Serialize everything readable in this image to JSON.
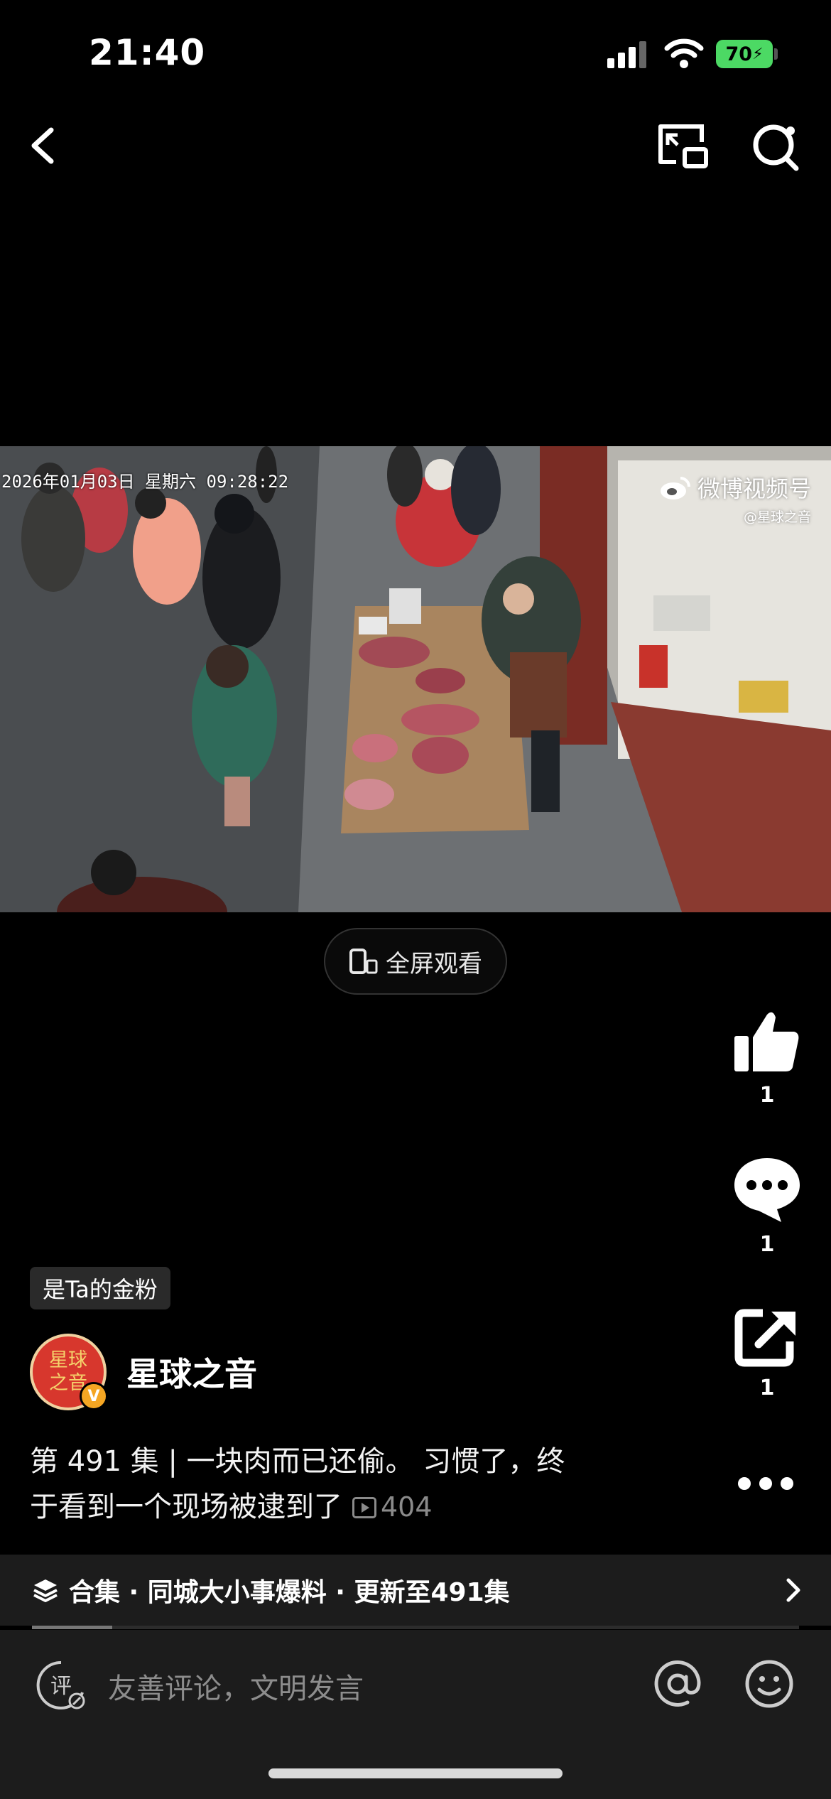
{
  "status_bar": {
    "time": "21:40",
    "battery": "70"
  },
  "video": {
    "timestamp": "2026年01月03日 星期六 09:28:22",
    "watermark": "微博视频号",
    "watermark_handle": "@星球之音",
    "fullscreen_label": "全屏观看"
  },
  "actions": {
    "like_count": "1",
    "comment_count": "1",
    "share_count": "1"
  },
  "author": {
    "fan_tag": "是Ta的金粉",
    "name": "星球之音",
    "avatar_line1": "星球",
    "avatar_line2": "之音",
    "verified_mark": "V"
  },
  "post": {
    "desc_line1": "第 491 集 | 一块肉而已还偷。 习惯了，终",
    "desc_line2": "于看到一个现场被逮到了",
    "play_count": "404"
  },
  "collection": {
    "label": "合集 · 同城大小事爆料 · 更新至491集",
    "progress": 0.105
  },
  "comment_bar": {
    "placeholder": "友善评论，文明发言",
    "icon_glyph": "评"
  },
  "colors": {
    "accent": "#4cd964",
    "avatar_bg": "#d7372d",
    "badge": "#f5a623"
  },
  "icons": [
    "back-icon",
    "pip-icon",
    "search-icon",
    "like-icon",
    "comment-icon",
    "share-icon",
    "more-icon",
    "collection-icon",
    "chevron-right-icon",
    "at-icon",
    "emoji-icon"
  ]
}
